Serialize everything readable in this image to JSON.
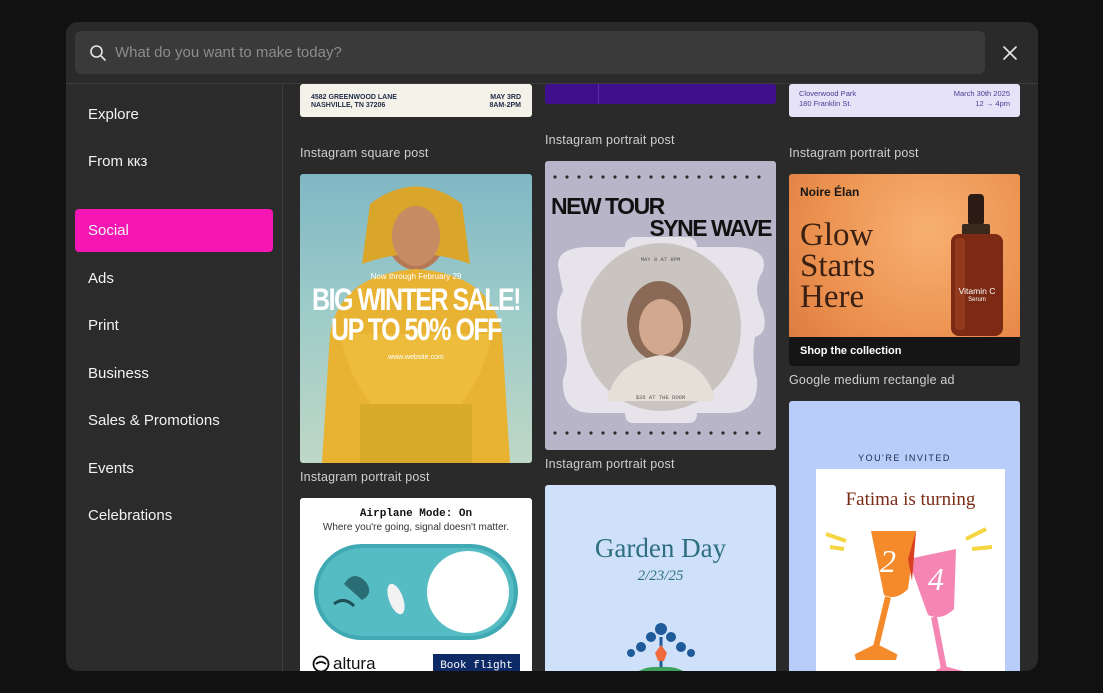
{
  "search": {
    "placeholder": "What do you want to make today?"
  },
  "sidebar": {
    "items": [
      {
        "label": "Explore"
      },
      {
        "label": "From ккз"
      },
      {
        "label": "Social"
      },
      {
        "label": "Ads"
      },
      {
        "label": "Print"
      },
      {
        "label": "Business"
      },
      {
        "label": "Sales & Promotions"
      },
      {
        "label": "Events"
      },
      {
        "label": "Celebrations"
      }
    ],
    "active": "Social"
  },
  "templates": {
    "col1_top": {
      "caption": "Instagram square post",
      "address": "4582 GREENWOOD LANE",
      "city": "NASHVILLE, TN 37206",
      "date": "MAY 3RD",
      "time": "8AM-2PM"
    },
    "col2_top": {
      "caption": "Instagram portrait post"
    },
    "col3_top": {
      "caption": "Instagram portrait post",
      "place": "Cloverwood Park",
      "street": "180 Franklin St.",
      "date": "March 30th 2025",
      "time": "12 → 4pm"
    },
    "winter_sale": {
      "caption": "Instagram portrait post",
      "kicker": "Now through February 29",
      "line1": "BIG WINTER SALE!",
      "line2": "UP TO 50% OFF",
      "site": "www.website.com"
    },
    "new_tour": {
      "caption": "Instagram portrait post",
      "line1": "NEW TOUR",
      "line2": "SYNE WAVE",
      "date": "MAY 8 AT 8PM",
      "price": "$35 AT THE DOOR"
    },
    "serum": {
      "caption": "Google medium rectangle ad",
      "brand": "Noire Élan",
      "headline1": "Glow",
      "headline2": "Starts",
      "headline3": "Here",
      "bottle_name": "Vitamin C",
      "bottle_sub": "Serum",
      "cta": "Shop the collection"
    },
    "airplane": {
      "title": "Airplane Mode: On",
      "subtitle": "Where you're going, signal doesn't matter.",
      "brand": "altura",
      "cta": "Book flight"
    },
    "garden": {
      "title": "Garden Day",
      "date": "2/23/25"
    },
    "invite": {
      "kicker": "YOU'RE INVITED",
      "name": "Fatima is turning",
      "digit1": "2",
      "digit2": "4"
    }
  },
  "colors": {
    "accent": "#f516b4",
    "modal_bg": "#2a2a2a",
    "search_bg": "#3a3a3a"
  }
}
